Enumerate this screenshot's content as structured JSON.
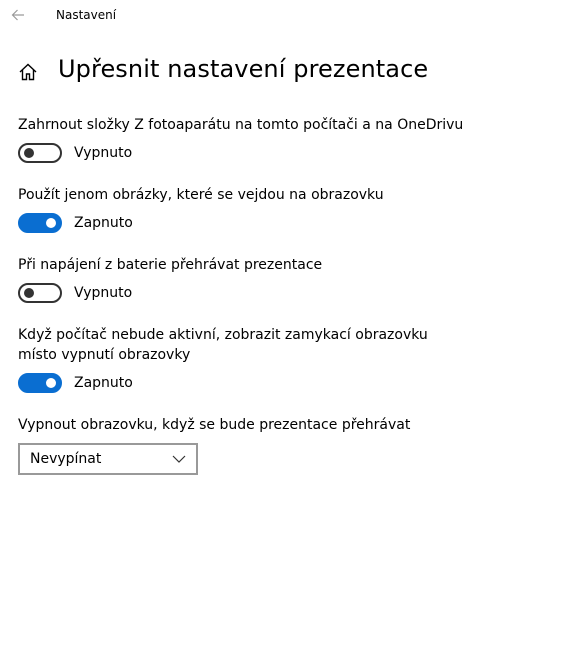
{
  "window": {
    "title": "Nastavení"
  },
  "page": {
    "title": "Upřesnit nastavení prezentace"
  },
  "icons": {
    "back": "back-arrow-icon",
    "home": "home-icon",
    "dropdown": "chevron-down-icon"
  },
  "colors": {
    "accent": "#0a6ed1",
    "toggle_off": "#333333",
    "dropdown_border": "#999999"
  },
  "settings": [
    {
      "label": "Zahrnout složky Z fotoaparátu na tomto počítači a na OneDrivu",
      "state": "Vypnuto",
      "on": false
    },
    {
      "label": "Použít jenom obrázky, které se vejdou na obrazovku",
      "state": "Zapnuto",
      "on": true
    },
    {
      "label": "Při napájení z baterie přehrávat prezentace",
      "state": "Vypnuto",
      "on": false
    },
    {
      "label": "Když počítač nebude aktivní, zobrazit zamykací obrazovku místo vypnutí obrazovky",
      "state": "Zapnuto",
      "on": true
    }
  ],
  "screen_off": {
    "label": "Vypnout obrazovku, když se bude prezentace přehrávat",
    "selected": "Nevypínat"
  }
}
